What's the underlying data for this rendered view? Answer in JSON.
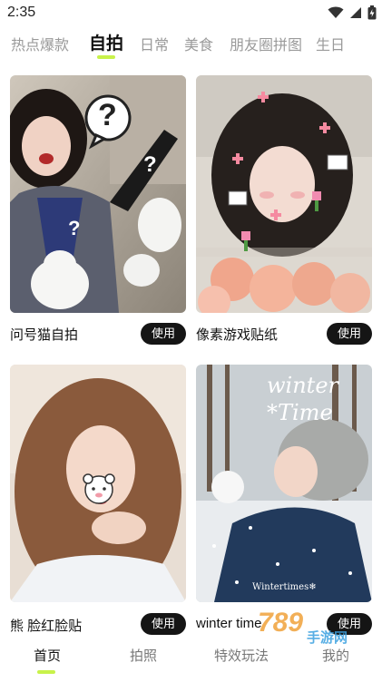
{
  "status_bar": {
    "time": "2:35"
  },
  "tabs": [
    {
      "label": "热点爆款"
    },
    {
      "label": "自拍"
    },
    {
      "label": "日常"
    },
    {
      "label": "美食"
    },
    {
      "label": "朋友圈拼图"
    },
    {
      "label": "生日"
    }
  ],
  "active_tab": "自拍",
  "cards": [
    {
      "title": "问号猫自拍",
      "button": "使用",
      "overlay_text": "?"
    },
    {
      "title": "像素游戏贴纸",
      "button": "使用"
    },
    {
      "title": "熊 脸红脸贴",
      "button": "使用"
    },
    {
      "title": "winter time",
      "button": "使用",
      "overlay_text": "winter *Time",
      "caption": "Wintertimes❄"
    }
  ],
  "bottom_nav": [
    {
      "label": "首页"
    },
    {
      "label": "拍照"
    },
    {
      "label": "特效玩法"
    },
    {
      "label": "我的"
    }
  ],
  "watermark": {
    "text": "789",
    "subtext": "手游网"
  },
  "colors": {
    "accent": "#c8f24a",
    "button_bg": "#151515"
  }
}
